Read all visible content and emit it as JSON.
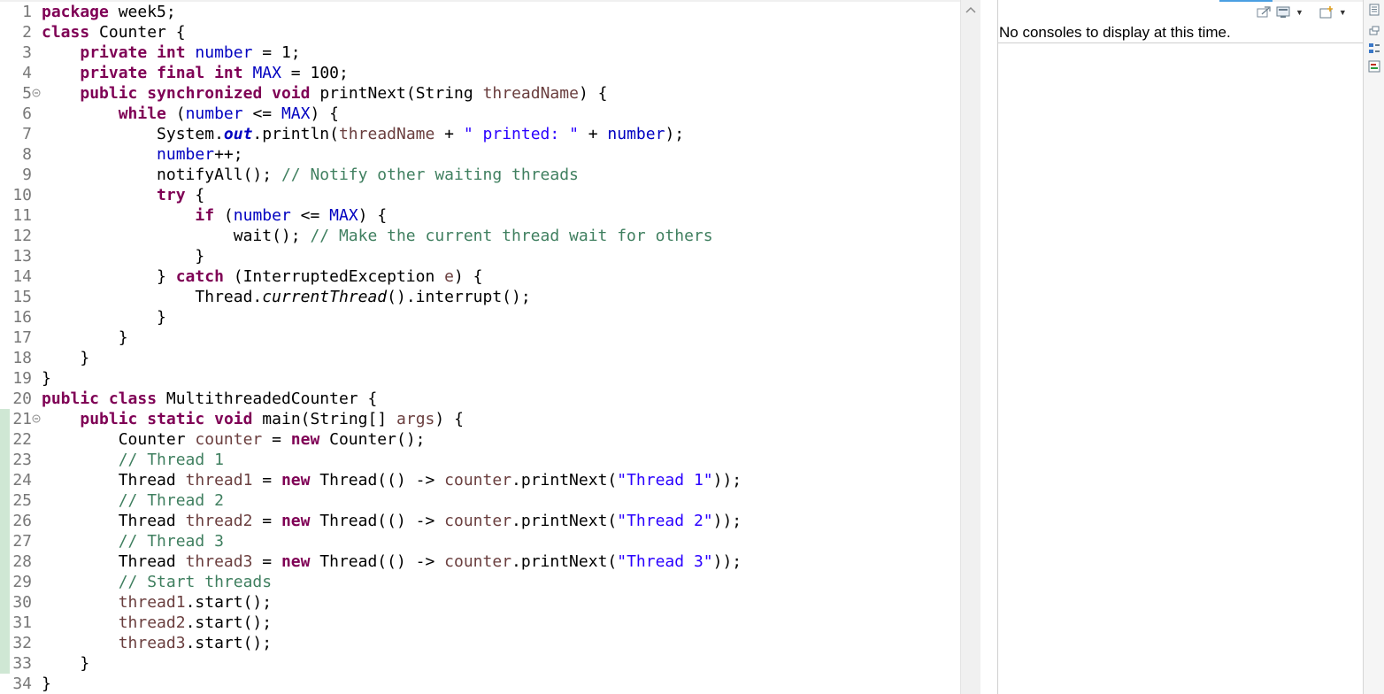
{
  "editor": {
    "lines": [
      {
        "n": "1",
        "tokens": [
          [
            "kw",
            "package"
          ],
          [
            "p",
            " week5;"
          ]
        ]
      },
      {
        "n": "2",
        "tokens": [
          [
            "kw",
            "class"
          ],
          [
            "p",
            " Counter {"
          ]
        ]
      },
      {
        "n": "3",
        "tokens": [
          [
            "p",
            "    "
          ],
          [
            "kw",
            "private"
          ],
          [
            "p",
            " "
          ],
          [
            "kw",
            "int"
          ],
          [
            "p",
            " "
          ],
          [
            "fld",
            "number"
          ],
          [
            "p",
            " = 1;"
          ]
        ]
      },
      {
        "n": "4",
        "tokens": [
          [
            "p",
            "    "
          ],
          [
            "kw",
            "private"
          ],
          [
            "p",
            " "
          ],
          [
            "kw",
            "final"
          ],
          [
            "p",
            " "
          ],
          [
            "kw",
            "int"
          ],
          [
            "p",
            " "
          ],
          [
            "fld",
            "MAX"
          ],
          [
            "p",
            " = 100;"
          ]
        ]
      },
      {
        "n": "5",
        "fold": true,
        "tokens": [
          [
            "p",
            "    "
          ],
          [
            "kw",
            "public"
          ],
          [
            "p",
            " "
          ],
          [
            "kw",
            "synchronized"
          ],
          [
            "p",
            " "
          ],
          [
            "kw",
            "void"
          ],
          [
            "p",
            " printNext(String "
          ],
          [
            "lv",
            "threadName"
          ],
          [
            "p",
            ") {"
          ]
        ]
      },
      {
        "n": "6",
        "tokens": [
          [
            "p",
            "        "
          ],
          [
            "kw",
            "while"
          ],
          [
            "p",
            " ("
          ],
          [
            "fld",
            "number"
          ],
          [
            "p",
            " <= "
          ],
          [
            "fld",
            "MAX"
          ],
          [
            "p",
            ") {"
          ]
        ]
      },
      {
        "n": "7",
        "tokens": [
          [
            "p",
            "            System."
          ],
          [
            "sfld",
            "out"
          ],
          [
            "p",
            ".println("
          ],
          [
            "lv",
            "threadName"
          ],
          [
            "p",
            " + "
          ],
          [
            "str",
            "\" printed: \""
          ],
          [
            "p",
            " + "
          ],
          [
            "fld",
            "number"
          ],
          [
            "p",
            ");"
          ]
        ]
      },
      {
        "n": "8",
        "tokens": [
          [
            "p",
            "            "
          ],
          [
            "fld",
            "number"
          ],
          [
            "p",
            "++;"
          ]
        ]
      },
      {
        "n": "9",
        "tokens": [
          [
            "p",
            "            notifyAll(); "
          ],
          [
            "cm",
            "// Notify other waiting threads"
          ]
        ]
      },
      {
        "n": "10",
        "tokens": [
          [
            "p",
            "            "
          ],
          [
            "kw",
            "try"
          ],
          [
            "p",
            " {"
          ]
        ]
      },
      {
        "n": "11",
        "tokens": [
          [
            "p",
            "                "
          ],
          [
            "kw",
            "if"
          ],
          [
            "p",
            " ("
          ],
          [
            "fld",
            "number"
          ],
          [
            "p",
            " <= "
          ],
          [
            "fld",
            "MAX"
          ],
          [
            "p",
            ") {"
          ]
        ]
      },
      {
        "n": "12",
        "tokens": [
          [
            "p",
            "                    wait(); "
          ],
          [
            "cm",
            "// Make the current thread wait for others"
          ]
        ]
      },
      {
        "n": "13",
        "tokens": [
          [
            "p",
            "                }"
          ]
        ]
      },
      {
        "n": "14",
        "tokens": [
          [
            "p",
            "            } "
          ],
          [
            "kw",
            "catch"
          ],
          [
            "p",
            " (InterruptedException "
          ],
          [
            "lv",
            "e"
          ],
          [
            "p",
            ") {"
          ]
        ]
      },
      {
        "n": "15",
        "tokens": [
          [
            "p",
            "                Thread."
          ],
          [
            "sm",
            "currentThread"
          ],
          [
            "p",
            "().interrupt();"
          ]
        ]
      },
      {
        "n": "16",
        "tokens": [
          [
            "p",
            "            }"
          ]
        ]
      },
      {
        "n": "17",
        "tokens": [
          [
            "p",
            "        }"
          ]
        ]
      },
      {
        "n": "18",
        "tokens": [
          [
            "p",
            "    }"
          ]
        ]
      },
      {
        "n": "19",
        "tokens": [
          [
            "p",
            "}"
          ]
        ]
      },
      {
        "n": "20",
        "tokens": [
          [
            "kw",
            "public"
          ],
          [
            "p",
            " "
          ],
          [
            "kw",
            "class"
          ],
          [
            "p",
            " MultithreadedCounter {"
          ]
        ]
      },
      {
        "n": "21",
        "fold": true,
        "marker": true,
        "tokens": [
          [
            "p",
            "    "
          ],
          [
            "kw",
            "public"
          ],
          [
            "p",
            " "
          ],
          [
            "kw",
            "static"
          ],
          [
            "p",
            " "
          ],
          [
            "kw",
            "void"
          ],
          [
            "p",
            " main(String[] "
          ],
          [
            "lv",
            "args"
          ],
          [
            "p",
            ") {"
          ]
        ]
      },
      {
        "n": "22",
        "marker": true,
        "tokens": [
          [
            "p",
            "        Counter "
          ],
          [
            "lv",
            "counter"
          ],
          [
            "p",
            " = "
          ],
          [
            "kw",
            "new"
          ],
          [
            "p",
            " Counter();"
          ]
        ]
      },
      {
        "n": "23",
        "marker": true,
        "tokens": [
          [
            "p",
            "        "
          ],
          [
            "cm",
            "// Thread 1"
          ]
        ]
      },
      {
        "n": "24",
        "marker": true,
        "tokens": [
          [
            "p",
            "        Thread "
          ],
          [
            "lv",
            "thread1"
          ],
          [
            "p",
            " = "
          ],
          [
            "kw",
            "new"
          ],
          [
            "p",
            " Thread(() -> "
          ],
          [
            "lv",
            "counter"
          ],
          [
            "p",
            ".printNext("
          ],
          [
            "str",
            "\"Thread 1\""
          ],
          [
            "p",
            "));"
          ]
        ]
      },
      {
        "n": "25",
        "marker": true,
        "tokens": [
          [
            "p",
            "        "
          ],
          [
            "cm",
            "// Thread 2"
          ]
        ]
      },
      {
        "n": "26",
        "marker": true,
        "tokens": [
          [
            "p",
            "        Thread "
          ],
          [
            "lv",
            "thread2"
          ],
          [
            "p",
            " = "
          ],
          [
            "kw",
            "new"
          ],
          [
            "p",
            " Thread(() -> "
          ],
          [
            "lv",
            "counter"
          ],
          [
            "p",
            ".printNext("
          ],
          [
            "str",
            "\"Thread 2\""
          ],
          [
            "p",
            "));"
          ]
        ]
      },
      {
        "n": "27",
        "marker": true,
        "tokens": [
          [
            "p",
            "        "
          ],
          [
            "cm",
            "// Thread 3"
          ]
        ]
      },
      {
        "n": "28",
        "marker": true,
        "tokens": [
          [
            "p",
            "        Thread "
          ],
          [
            "lv",
            "thread3"
          ],
          [
            "p",
            " = "
          ],
          [
            "kw",
            "new"
          ],
          [
            "p",
            " Thread(() -> "
          ],
          [
            "lv",
            "counter"
          ],
          [
            "p",
            ".printNext("
          ],
          [
            "str",
            "\"Thread 3\""
          ],
          [
            "p",
            "));"
          ]
        ]
      },
      {
        "n": "29",
        "marker": true,
        "tokens": [
          [
            "p",
            "        "
          ],
          [
            "cm",
            "// Start threads"
          ]
        ]
      },
      {
        "n": "30",
        "marker": true,
        "tokens": [
          [
            "p",
            "        "
          ],
          [
            "lv",
            "thread1"
          ],
          [
            "p",
            ".start();"
          ]
        ]
      },
      {
        "n": "31",
        "marker": true,
        "tokens": [
          [
            "p",
            "        "
          ],
          [
            "lv",
            "thread2"
          ],
          [
            "p",
            ".start();"
          ]
        ]
      },
      {
        "n": "32",
        "marker": true,
        "tokens": [
          [
            "p",
            "        "
          ],
          [
            "lv",
            "thread3"
          ],
          [
            "p",
            ".start();"
          ]
        ]
      },
      {
        "n": "33",
        "marker": true,
        "tokens": [
          [
            "p",
            "    }"
          ]
        ]
      },
      {
        "n": "34",
        "tokens": [
          [
            "p",
            "}"
          ]
        ]
      }
    ]
  },
  "console": {
    "message": "No consoles to display at this time.",
    "toolbar_icons": [
      "pin-console-icon",
      "display-console-icon",
      "open-console-icon"
    ]
  },
  "colors": {
    "keyword": "#7f0055",
    "field": "#0000c0",
    "comment": "#3f7f5f",
    "string": "#2a00ff",
    "local_variable": "#6a3e3e"
  }
}
